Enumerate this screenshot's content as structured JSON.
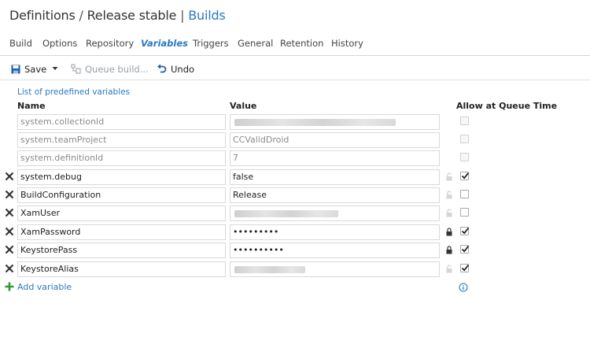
{
  "breadcrumb": {
    "part1": "Definitions",
    "sep1": "/",
    "part2": "Release stable",
    "sep2": "|",
    "part3": "Builds"
  },
  "tabs": [
    {
      "label": "Build"
    },
    {
      "label": "Options"
    },
    {
      "label": "Repository"
    },
    {
      "label": "Variables",
      "active": true
    },
    {
      "label": "Triggers"
    },
    {
      "label": "General"
    },
    {
      "label": "Retention"
    },
    {
      "label": "History"
    }
  ],
  "toolbar": {
    "save_label": "Save",
    "queue_label": "Queue build...",
    "undo_label": "Undo"
  },
  "predefined_link": "List of predefined variables",
  "columns": {
    "name": "Name",
    "value": "Value",
    "allow": "Allow at Queue Time"
  },
  "variables": [
    {
      "name": "system.collectionId",
      "value": "",
      "readonly": true,
      "allow_queue": false
    },
    {
      "name": "system.teamProject",
      "value": "CCValidDroid",
      "readonly": true,
      "allow_queue": false
    },
    {
      "name": "system.definitionId",
      "value": "7",
      "readonly": true,
      "allow_queue": false
    },
    {
      "name": "system.debug",
      "value": "false",
      "readonly": false,
      "secret": false,
      "allow_queue": true
    },
    {
      "name": "BuildConfiguration",
      "value": "Release",
      "readonly": false,
      "secret": false,
      "allow_queue": false
    },
    {
      "name": "XamUser",
      "value": "",
      "readonly": false,
      "secret": false,
      "allow_queue": false
    },
    {
      "name": "XamPassword",
      "value": "•••••••••",
      "readonly": false,
      "secret": true,
      "allow_queue": true
    },
    {
      "name": "KeystorePass",
      "value": "••••••••••",
      "readonly": false,
      "secret": true,
      "allow_queue": true
    },
    {
      "name": "KeystoreAlias",
      "value": "",
      "readonly": false,
      "secret": false,
      "allow_queue": true
    }
  ],
  "add_variable_label": "Add variable",
  "colors": {
    "accent": "#2b79c2",
    "add_icon": "#339933"
  }
}
